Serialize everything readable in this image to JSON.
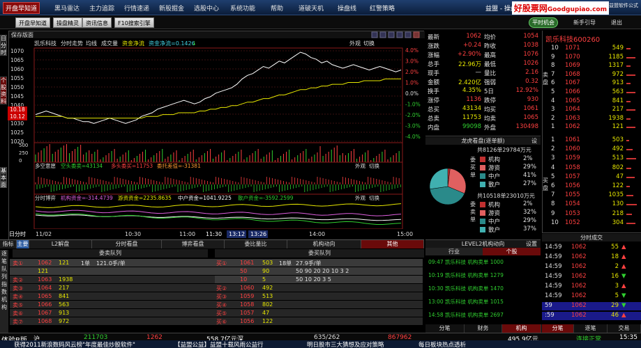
{
  "menu": {
    "items": [
      "开盘早知道",
      "黑马雷达",
      "主力追踪",
      "行情速递",
      "新股掘金",
      "选股中心",
      "系统功能",
      "帮助",
      "道破天机",
      "操盘线",
      "红警策略"
    ],
    "active": 0,
    "title_right": "益盟 - 操盘手",
    "brand": "好股票网",
    "brand_url": "Goodgupiao.com",
    "brand_small": "益盟软件公式"
  },
  "toolbar": {
    "buttons": [
      "开盘早知道",
      "操盘精灵",
      "资讯信息",
      "F10搜索引擎"
    ],
    "user_label": "平时机会",
    "link1": "新手引导",
    "link2": "退出"
  },
  "left_tabs": [
    "日分时",
    "个股资料",
    "基本面",
    "财务"
  ],
  "chart": {
    "save_label": "保存版面",
    "stock_name": "凯乐科技",
    "mode_label": "分时走势",
    "avg_label": "均线",
    "vol_label": "成交量",
    "flow_label": "资金净流",
    "flow_value": "资金净流=0.1426",
    "flow_arrow": "↓",
    "ext_label": "外观",
    "switch_label": "切换",
    "price_ticks": [
      "1070",
      "1065",
      "1060",
      "1055",
      "1050",
      "1045",
      "1040",
      "1035",
      "1030",
      "1025",
      "1020"
    ],
    "pct_ticks": [
      "4.0%",
      "3.0%",
      "2.0%",
      "1.0%",
      "0.0%",
      "-1.0%",
      "-2.0%",
      "-3.0%",
      "-4.0%"
    ],
    "left_badge1": "10.18",
    "left_badge2": "10.12",
    "vol_ticks": [
      "500",
      "250",
      "0"
    ],
    "panel2_title": "多空意愿",
    "panel2_a": "空头委卖=43134",
    "panel2_b": "多头委买=11753",
    "panel2_c": "委托差值=-31381",
    "panel3_title": "分时博弈",
    "panel3_a": "机构资金=-314.4739",
    "panel3_b": "游资资金=2235.8635",
    "panel3_c": "中户资金=1041.9225",
    "panel3_d": "散户资金=-3592.2599",
    "time_labels": [
      "11/02",
      "10:30",
      "11:00",
      "11:30",
      "13:12",
      "13:26",
      "14:00",
      "15:00"
    ],
    "time_prefix": "日分时"
  },
  "chart_data": {
    "type": "line",
    "price_series": [
      1035,
      1036,
      1037,
      1036,
      1035,
      1034,
      1033,
      1033,
      1032,
      1031,
      1031,
      1030,
      1031,
      1032,
      1033,
      1032,
      1031,
      1030,
      1031,
      1032,
      1034,
      1035,
      1036,
      1038,
      1039,
      1040,
      1041,
      1042,
      1043,
      1042,
      1041,
      1042,
      1044,
      1045,
      1047,
      1048,
      1049,
      1050,
      1052,
      1055,
      1057,
      1058,
      1060,
      1062,
      1061,
      1063,
      1065,
      1064,
      1066,
      1068,
      1070,
      1069,
      1067,
      1066,
      1064,
      1065,
      1063,
      1062,
      1061,
      1062,
      1063,
      1062,
      1061,
      1060,
      1061,
      1062,
      1061,
      1060,
      1059,
      1060
    ],
    "avg_series": [
      1034,
      1034,
      1034,
      1034,
      1034,
      1034,
      1033,
      1033,
      1033,
      1033,
      1033,
      1033,
      1033,
      1033,
      1033,
      1033,
      1033,
      1033,
      1033,
      1033,
      1033,
      1034,
      1034,
      1034,
      1035,
      1035,
      1035,
      1036,
      1036,
      1036,
      1036,
      1037,
      1037,
      1038,
      1038,
      1039,
      1039,
      1040,
      1040,
      1041,
      1042,
      1042,
      1043,
      1044,
      1044,
      1045,
      1046,
      1046,
      1047,
      1048,
      1049,
      1049,
      1050,
      1050,
      1051,
      1051,
      1052,
      1052,
      1052,
      1053,
      1053,
      1053,
      1054,
      1054,
      1054,
      1054,
      1055,
      1055,
      1055,
      1055
    ],
    "ylim": [
      1020,
      1070
    ]
  },
  "bottom": {
    "tabs": [
      "指标",
      "主要",
      "L2解盘",
      "分时看盘",
      "博弈看盘",
      "委比量比",
      "机构动向",
      "其他"
    ],
    "sel": 7,
    "queue_title": "委卖队列",
    "queue_title2": "委买队列",
    "sell_rows": [
      {
        "label": "卖①",
        "price": "1062",
        "vol": "121",
        "extra": "1单",
        "avg": "121.0手/单"
      },
      {
        "label": "",
        "price": "121",
        "vol": "",
        "extra": "",
        "avg": ""
      },
      {
        "label": "卖②",
        "price": "1063",
        "vol": "1938",
        "extra": "",
        "avg": ""
      },
      {
        "label": "卖③",
        "price": "1064",
        "vol": "217",
        "extra": "",
        "avg": ""
      },
      {
        "label": "卖④",
        "price": "1065",
        "vol": "841",
        "extra": "",
        "avg": ""
      },
      {
        "label": "卖⑤",
        "price": "1066",
        "vol": "563",
        "extra": "",
        "avg": ""
      },
      {
        "label": "卖⑥",
        "price": "1067",
        "vol": "913",
        "extra": "",
        "avg": ""
      },
      {
        "label": "卖⑦",
        "price": "1068",
        "vol": "972",
        "extra": "",
        "avg": ""
      }
    ],
    "buy_rows": [
      {
        "label": "买①",
        "price": "1061",
        "vol": "503",
        "extra": "18单",
        "avg": "27.9手/单"
      },
      {
        "label": "",
        "price": "50",
        "vol": "90",
        "extra": "",
        "avg": "50 90 20 20 10 3 2"
      },
      {
        "label": "",
        "price": "10",
        "vol": "5",
        "extra": "",
        "avg": "50 10 20 3 5"
      },
      {
        "label": "买②",
        "price": "1060",
        "vol": "492",
        "extra": "",
        "avg": ""
      },
      {
        "label": "买③",
        "price": "1059",
        "vol": "513",
        "extra": "",
        "avg": ""
      },
      {
        "label": "买④",
        "price": "1058",
        "vol": "802",
        "extra": "",
        "avg": ""
      },
      {
        "label": "买⑤",
        "price": "1057",
        "vol": "47",
        "extra": "",
        "avg": ""
      },
      {
        "label": "买⑥",
        "price": "1056",
        "vol": "122",
        "extra": "",
        "avg": ""
      }
    ],
    "side_tabs": [
      "逐笔",
      "队列",
      "指数",
      "机构"
    ]
  },
  "info": {
    "rows": [
      [
        "最新",
        "1062",
        "均价",
        "1054"
      ],
      [
        "涨跌",
        "+0.24",
        "昨收",
        "1038"
      ],
      [
        "涨幅",
        "+2.90%",
        "最高",
        "1076"
      ],
      [
        "总手",
        "22.96万",
        "最低",
        "1026"
      ],
      [
        "现手",
        "—",
        "量比",
        "2.16"
      ],
      [
        "金额",
        "2.420亿",
        "强弱",
        "0.32"
      ],
      [
        "换手",
        "4.35%",
        "5日",
        "12.92%"
      ],
      [
        "涨停",
        "1136",
        "跌停",
        "930"
      ],
      [
        "总买",
        "43134",
        "均买",
        "1061"
      ],
      [
        "总卖",
        "11753",
        "均卖",
        "1065"
      ],
      [
        "内盘",
        "99098",
        "外盘",
        "130498"
      ]
    ]
  },
  "longhu": {
    "title": "龙虎看盘(逐单额)",
    "setting": "设",
    "buy_label": "委买单",
    "sell_label": "委卖单",
    "buy_total": "共8126单29784万元",
    "sell_total": "共10518单23010万元",
    "buy_rows": [
      [
        "机构",
        "2%"
      ],
      [
        "游资",
        "29%"
      ],
      [
        "中户",
        "41%"
      ],
      [
        "散户",
        "27%"
      ]
    ],
    "sell_rows": [
      [
        "机构",
        "2%"
      ],
      [
        "游资",
        "32%"
      ],
      [
        "中户",
        "29%"
      ],
      [
        "散户",
        "37%"
      ]
    ],
    "pie_colors": [
      "#c03030",
      "#e06060",
      "#2a8a8a",
      "#40b0b0"
    ]
  },
  "l2": {
    "title": "LEVEL2机构动向",
    "setting": "设置",
    "tab1": "行业",
    "tab2": "个股",
    "rows": [
      "09:47 凯乐科技 机构卖单 1000",
      "10:19 凯乐科技 机构卖单 1279",
      "10:30 凯乐科技 机构卖单 1470",
      "13:00 凯乐科技 机构卖单 1015",
      "14:58 凯乐科技 机构卖单 2697"
    ]
  },
  "orderbook": {
    "name": "凯乐科技600260",
    "sell": [
      [
        "10",
        "1071",
        "549"
      ],
      [
        "9",
        "1070",
        "1185"
      ],
      [
        "8",
        "1069",
        "1317"
      ],
      [
        "7",
        "1068",
        "972"
      ],
      [
        "6",
        "1067",
        "913"
      ],
      [
        "5",
        "1066",
        "563"
      ],
      [
        "4",
        "1065",
        "841"
      ],
      [
        "3",
        "1064",
        "217"
      ],
      [
        "2",
        "1063",
        "1938"
      ],
      [
        "1",
        "1062",
        "121"
      ]
    ],
    "buy": [
      [
        "1",
        "1061",
        "503"
      ],
      [
        "2",
        "1060",
        "492"
      ],
      [
        "3",
        "1059",
        "513"
      ],
      [
        "4",
        "1058",
        "802"
      ],
      [
        "5",
        "1057",
        "47"
      ],
      [
        "6",
        "1056",
        "122"
      ],
      [
        "7",
        "1055",
        "1035"
      ],
      [
        "8",
        "1054",
        "130"
      ],
      [
        "9",
        "1053",
        "218"
      ],
      [
        "10",
        "1052",
        "304"
      ]
    ],
    "side_sell": "卖盘",
    "side_buy": "买盘"
  },
  "fenbi": {
    "title": "分时成交",
    "rows": [
      [
        "14:59",
        "1062",
        "55",
        "▲"
      ],
      [
        "14:59",
        "1062",
        "18",
        "▲"
      ],
      [
        "14:59",
        "1062",
        "2",
        "▲"
      ],
      [
        "14:59",
        "1062",
        "16",
        "▼"
      ],
      [
        "14:59",
        "1062",
        "3",
        "▲"
      ],
      [
        "14:59",
        "1062",
        "5",
        "▼"
      ],
      [
        "59",
        "1062",
        "29",
        "▼"
      ],
      [
        ":59",
        "1062",
        "46",
        "▲"
      ]
    ]
  },
  "rtabs": [
    "分笔",
    "财务",
    "机构",
    "分笔",
    "逐笔",
    "交易"
  ],
  "status": {
    "s1": "体验B版",
    "s2": "沪",
    "s3": "211703",
    "s4": "1262",
    "s5": "558.7亿元",
    "s6": "深",
    "s7": "635/262",
    "s8": "867962",
    "s9": "495.9亿元",
    "s10": "连接正常",
    "s11": "15:35"
  },
  "ticker": {
    "t1": "获得2011新浪数码风云榜\"年度最佳炒股软件\"",
    "t2": "【益盟公益】益盟十载风雨公益行",
    "t3": "明日股市三大猜想及应对策略",
    "t4": "每日板块热点透析"
  }
}
